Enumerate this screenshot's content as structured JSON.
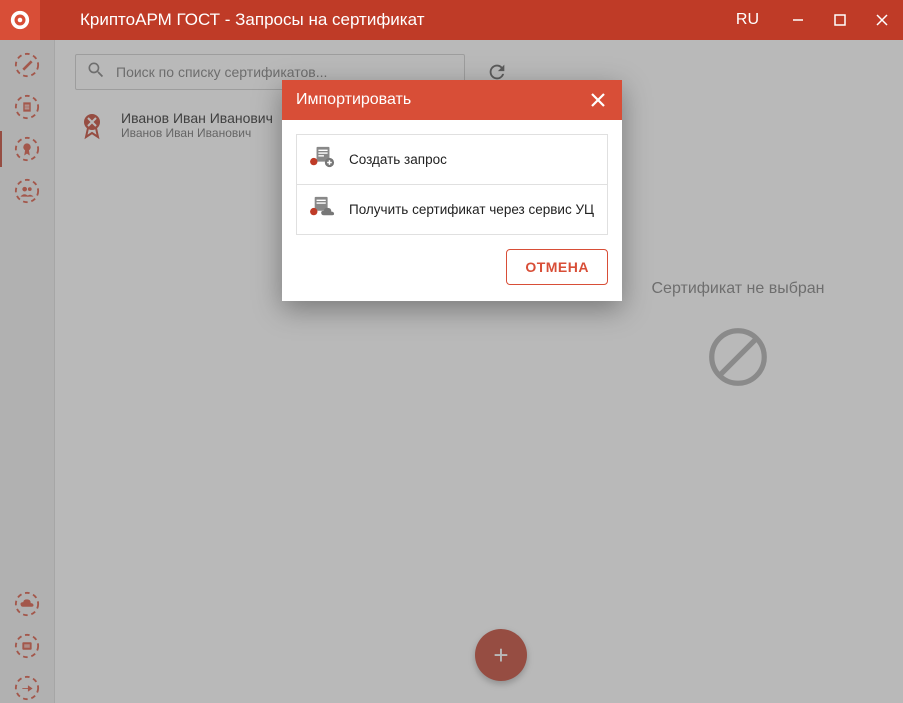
{
  "window": {
    "title": "КриптоАРМ ГОСТ - Запросы на сертификат",
    "lang": "RU"
  },
  "search": {
    "placeholder": "Поиск по списку сертификатов..."
  },
  "certs": {
    "items": [
      {
        "name": "Иванов Иван Иванович",
        "sub": "Иванов Иван Иванович"
      }
    ]
  },
  "right": {
    "empty_msg": "Сертификат не выбран"
  },
  "dialog": {
    "title": "Импортировать",
    "options": [
      {
        "label": "Создать запрос"
      },
      {
        "label": "Получить сертификат через сервис УЦ"
      }
    ],
    "cancel": "ОТМЕНА"
  },
  "fab": {
    "glyph": "+"
  }
}
